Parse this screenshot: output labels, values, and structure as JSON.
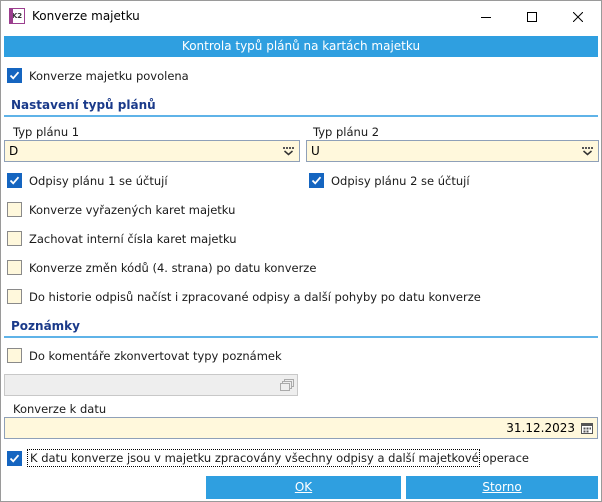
{
  "window": {
    "title": "Konverze majetku",
    "app_icon_text": "K2"
  },
  "banner": {
    "label": "Kontrola typů plánů na kartách majetku"
  },
  "top": {
    "enable_label": "Konverze majetku povolena",
    "enable_checked": true
  },
  "plans": {
    "section_title": "Nastavení typů plánů",
    "plan1_label": "Typ plánu 1",
    "plan1_value": "D",
    "plan2_label": "Typ plánu 2",
    "plan2_value": "U",
    "options": [
      {
        "label": "Odpisy plánu 1 se účtují",
        "checked": true
      },
      {
        "label": "Odpisy plánu 2 se účtují",
        "checked": true
      },
      {
        "label": "Konverze vyřazených karet majetku",
        "checked": false
      },
      {
        "label": "Zachovat interní čísla karet majetku",
        "checked": false
      },
      {
        "label": "Konverze změn kódů (4. strana) po datu konverze",
        "checked": false
      },
      {
        "label": "Do historie odpisů načíst i zpracované odpisy a další pohyby po datu konverze",
        "checked": false
      }
    ]
  },
  "notes": {
    "section_title": "Poznámky",
    "convert_label": "Do komentáře zkonvertovat typy poznámek",
    "convert_checked": false,
    "types_value": ""
  },
  "date": {
    "label": "Konverze k datu",
    "value": "31.12.2023"
  },
  "final": {
    "label": "K datu konverze jsou v majetku zpracovány všechny odpisy a další majetkové operace",
    "checked": true
  },
  "buttons": {
    "ok": "OK",
    "cancel": "Storno"
  },
  "colors": {
    "accent": "#2f9fe0",
    "check": "#1565c0",
    "field_bg": "#fff8dc",
    "section_title": "#1a3a8a"
  }
}
